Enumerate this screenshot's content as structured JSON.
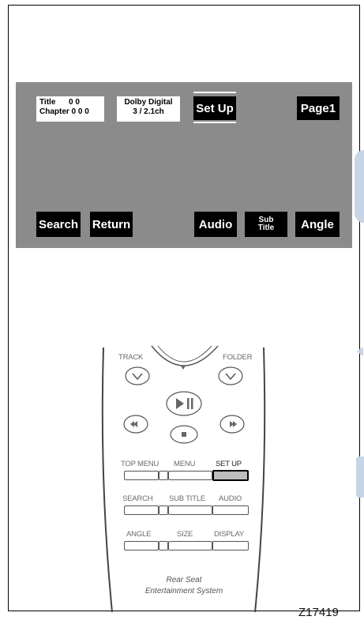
{
  "osd": {
    "title_label": "Title      0 0",
    "chapter_label": "Chapter 0 0 0",
    "audio_format": "Dolby Digital",
    "audio_channels": "3 / 2.1ch",
    "setup": "Set Up",
    "page": "Page1",
    "search": "Search",
    "return": "Return",
    "audio": "Audio",
    "subtitle_line1": "Sub",
    "subtitle_line2": "Title",
    "angle": "Angle"
  },
  "remote": {
    "track": "TRACK",
    "folder": "FOLDER",
    "top_menu": "TOP MENU",
    "menu": "MENU",
    "set_up": "SET UP",
    "search": "SEARCH",
    "sub_title": "SUB TITLE",
    "audio": "AUDIO",
    "angle": "ANGLE",
    "size": "SIZE",
    "display": "DISPLAY",
    "brand_line1": "Rear Seat",
    "brand_line2": "Entertainment System",
    "active_button": "set_up"
  },
  "figure_id": "Z17419"
}
